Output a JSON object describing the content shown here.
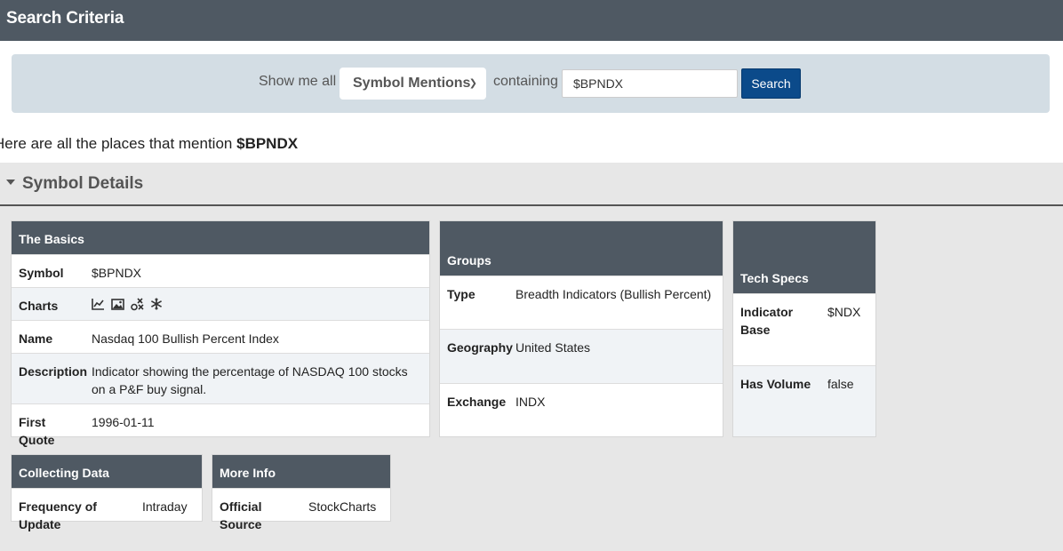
{
  "header": {
    "title": "Search Criteria"
  },
  "search": {
    "show_label": "Show me all",
    "select_value": "Symbol Mentions",
    "containing_label": "containing",
    "input_value": "$BPNDX",
    "button_label": "Search"
  },
  "mention": {
    "prefix": "Here are all the places that mention",
    "symbol": "$BPNDX"
  },
  "details": {
    "title": "Symbol Details",
    "basics": {
      "title": "The Basics",
      "symbol_label": "Symbol",
      "symbol_value": "$BPNDX",
      "charts_label": "Charts",
      "chart_icons": [
        "line-chart-icon",
        "image-chart-icon",
        "pnf-chart-icon",
        "seasonality-icon"
      ],
      "name_label": "Name",
      "name_value": "Nasdaq 100 Bullish Percent Index",
      "description_label": "Description",
      "description_value": "Indicator showing the percentage of NASDAQ 100 stocks on a P&F buy signal.",
      "first_quote_label": "First Quote",
      "first_quote_value": "1996-01-11"
    },
    "groups": {
      "title": "Groups",
      "type_label": "Type",
      "type_value": "Breadth Indicators (Bullish Percent)",
      "geography_label": "Geography",
      "geography_value": "United States",
      "exchange_label": "Exchange",
      "exchange_value": "INDX"
    },
    "tech": {
      "title": "Tech Specs",
      "indicator_base_label": "Indicator Base",
      "indicator_base_value": "$NDX",
      "has_volume_label": "Has Volume",
      "has_volume_value": "false"
    },
    "collecting": {
      "title": "Collecting Data",
      "frequency_label": "Frequency of Update",
      "frequency_value": "Intraday"
    },
    "more_info": {
      "title": "More Info",
      "source_label": "Official Source",
      "source_value": "StockCharts"
    }
  },
  "colors": {
    "header_bg": "#4f5963",
    "search_bg": "#d3dde4",
    "button_bg": "#0b4a8a",
    "panel_bg": "#e7e7e7"
  }
}
